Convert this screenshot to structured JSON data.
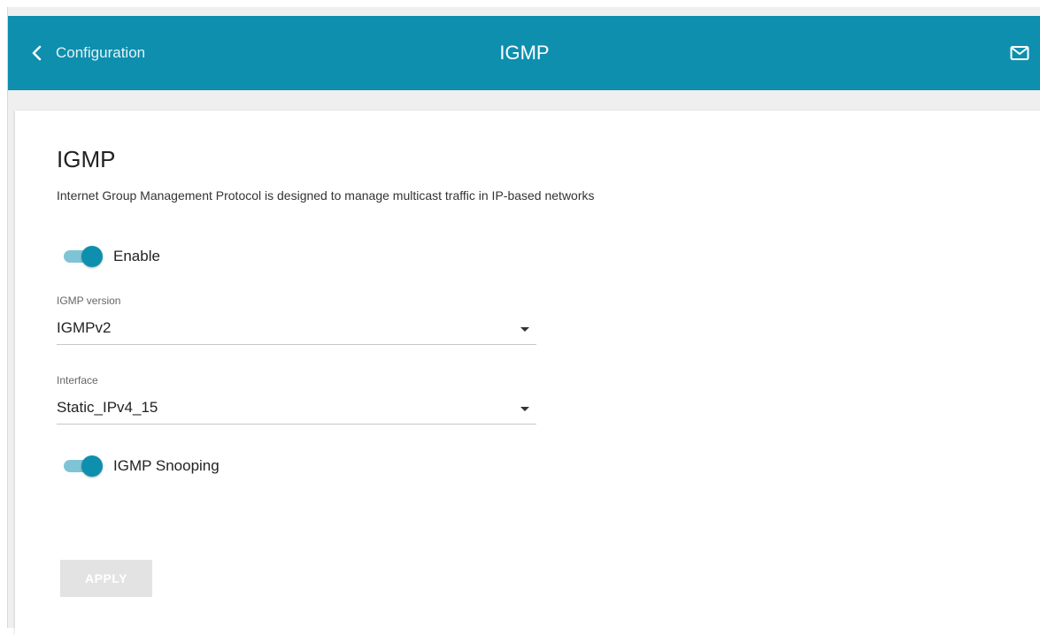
{
  "header": {
    "back_label": "Configuration",
    "title": "IGMP",
    "back_icon": "chevron-left-icon",
    "mail_icon": "mail-icon",
    "background_color": "#0e8fae"
  },
  "main": {
    "heading": "IGMP",
    "description": "Internet Group Management Protocol is designed to manage multicast traffic in IP-based networks",
    "enable": {
      "label": "Enable",
      "checked": true
    },
    "igmp_version": {
      "label": "IGMP version",
      "value": "IGMPv2"
    },
    "interface": {
      "label": "Interface",
      "value": "Static_IPv4_15"
    },
    "snooping": {
      "label": "IGMP Snooping",
      "checked": true
    },
    "apply_label": "APPLY",
    "apply_disabled": true
  }
}
